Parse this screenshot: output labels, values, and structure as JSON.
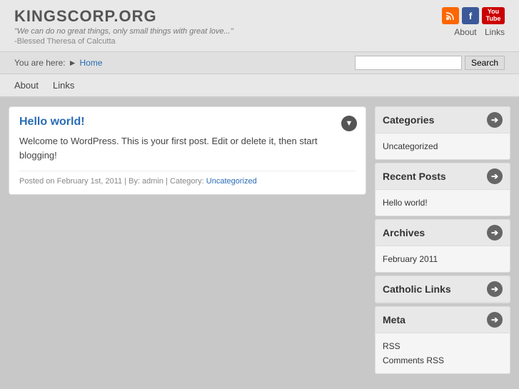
{
  "site": {
    "title": "KINGSCORP.ORG",
    "tagline": "\"We can do no great things, only small things with great love...\"",
    "author": "-Blessed Theresa of Calcutta"
  },
  "header": {
    "about_label": "About",
    "links_label": "Links",
    "social": [
      {
        "name": "RSS",
        "label": "RSS"
      },
      {
        "name": "Facebook",
        "label": "f"
      },
      {
        "name": "YouTube",
        "label": "You\nTube"
      }
    ]
  },
  "breadcrumb": {
    "prefix": "You are here:",
    "home": "Home"
  },
  "search": {
    "placeholder": "",
    "button_label": "Search"
  },
  "nav": {
    "items": [
      {
        "label": "About"
      },
      {
        "label": "Links"
      }
    ]
  },
  "post": {
    "title": "Hello world!",
    "body": "Welcome to WordPress. This is your first post. Edit or delete it, then start blogging!",
    "meta_prefix": "Posted on",
    "meta_date": "February 1st, 2011",
    "meta_by": "By: admin",
    "meta_category_label": "Category:",
    "meta_category": "Uncategorized",
    "toggle_icon": "▼"
  },
  "sidebar": {
    "widgets": [
      {
        "id": "categories",
        "title": "Categories",
        "items": [
          "Uncategorized"
        ]
      },
      {
        "id": "recent-posts",
        "title": "Recent Posts",
        "items": [
          "Hello world!"
        ]
      },
      {
        "id": "archives",
        "title": "Archives",
        "items": [
          "February 2011"
        ]
      },
      {
        "id": "catholic-links",
        "title": "Catholic Links",
        "items": []
      },
      {
        "id": "meta",
        "title": "Meta",
        "items": [
          "RSS",
          "Comments RSS"
        ]
      }
    ],
    "arrow_icon": "➔"
  }
}
